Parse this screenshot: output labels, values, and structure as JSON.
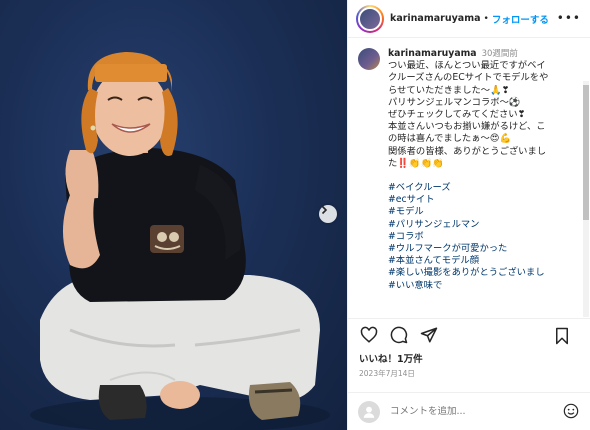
{
  "header": {
    "username": "karinamaruyama",
    "dot": "•",
    "follow_label": "フォローする",
    "more_label": "•••"
  },
  "caption": {
    "username": "karinamaruyama",
    "time": "30週間前",
    "lines": [
      "つい最近、ほんとつい最近ですがベイ",
      "クルーズさんのECサイトでモデルをや",
      "らせていただきました〜🙏❣",
      "パリサンジェルマンコラボ〜⚽",
      "ぜひチェックしてみてください❣",
      "本並さんいつもお揃い嫌がるけど、こ",
      "の時は喜んでましたぁ〜😍💪",
      "関係者の皆様、ありがとうございまし",
      "た‼️👏👏👏"
    ],
    "hashtags": [
      "#ベイクルーズ",
      "#ecサイト",
      "#モデル",
      "#パリサンジェルマン",
      "#コラボ",
      "#ウルフマークが可愛かった",
      "#本並さんてモデル顔",
      "#楽しい撮影をありがとうございまし",
      "#いい意味で"
    ]
  },
  "actions": {
    "like_icon": "heart-icon",
    "comment_icon": "comment-icon",
    "share_icon": "share-icon",
    "save_icon": "bookmark-icon"
  },
  "likes_text": "いいね！1万件",
  "date_text": "2023年7月14日",
  "comment": {
    "placeholder": "コメントを追加...",
    "emoji_icon": "smiley-icon"
  },
  "photo": {
    "next_icon": "chevron-right-icon"
  },
  "colors": {
    "link": "#0095f6",
    "hashtag": "#00376b",
    "muted": "#8e8e8e",
    "backdrop": "#1b2f56"
  }
}
